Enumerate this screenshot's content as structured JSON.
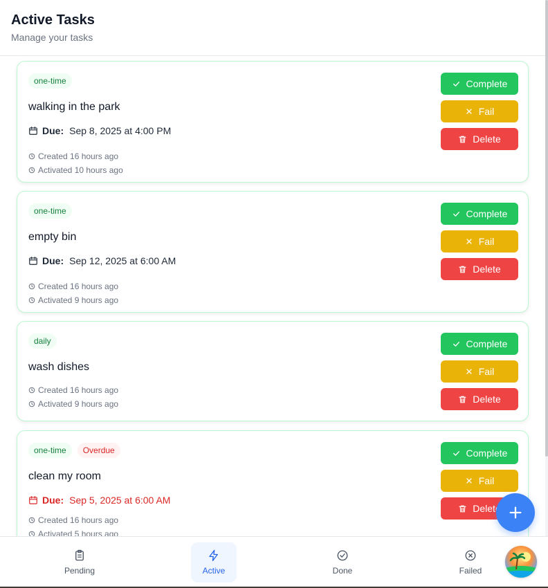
{
  "header": {
    "title": "Active Tasks",
    "subtitle": "Manage your tasks"
  },
  "labels": {
    "complete": "Complete",
    "fail": "Fail",
    "delete": "Delete",
    "due": "Due:"
  },
  "tasks": [
    {
      "tags": [
        "one-time"
      ],
      "title": "walking in the park",
      "due": "Sep 8, 2025 at 4:00 PM",
      "created": "Created 16 hours ago",
      "activated": "Activated 10 hours ago"
    },
    {
      "tags": [
        "one-time"
      ],
      "title": "empty bin",
      "due": "Sep 12, 2025 at 6:00 AM",
      "created": "Created 16 hours ago",
      "activated": "Activated 9 hours ago"
    },
    {
      "tags": [
        "daily"
      ],
      "title": "wash dishes",
      "created": "Created 16 hours ago",
      "activated": "Activated 9 hours ago"
    },
    {
      "tags": [
        "one-time",
        "Overdue"
      ],
      "title": "clean my room",
      "due": "Sep 5, 2025 at 6:00 AM",
      "due_overdue": true,
      "created": "Created 16 hours ago",
      "activated": "Activated 5 hours ago"
    }
  ],
  "nav": {
    "items": [
      {
        "label": "Pending",
        "icon": "clipboard-icon"
      },
      {
        "label": "Active",
        "icon": "lightning-icon",
        "active": true
      },
      {
        "label": "Done",
        "icon": "check-circle-icon"
      },
      {
        "label": "Failed",
        "icon": "x-circle-icon"
      }
    ]
  },
  "colors": {
    "complete": "#22c55e",
    "fail": "#eab308",
    "delete": "#ef4444",
    "accent": "#3b82f6",
    "overdue": "#dc2626"
  }
}
